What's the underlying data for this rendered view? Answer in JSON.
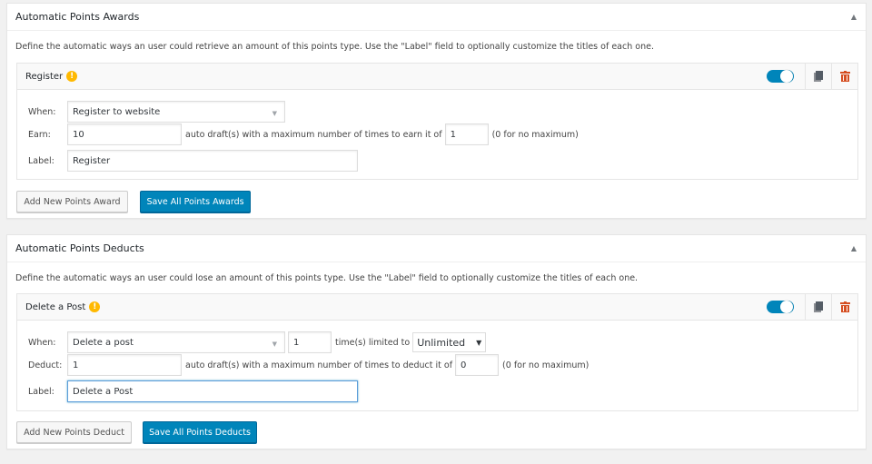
{
  "awards": {
    "title": "Automatic Points Awards",
    "toggle_icon": "triangle-up",
    "description": "Define the automatic ways an user could retrieve an amount of this points type. Use the \"Label\" field to optionally customize the titles of each one.",
    "item": {
      "title": "Register",
      "warning_icon": "!",
      "enabled": true,
      "when_label": "When:",
      "when_value": "Register to website",
      "earn_label": "Earn:",
      "earn_value": "10",
      "earn_suffix": "auto draft(s) with a maximum number of times to earn it of",
      "max_value": "1",
      "max_hint": "(0 for no maximum)",
      "label_label": "Label:",
      "label_value": "Register"
    },
    "add_button": "Add New Points Award",
    "save_button": "Save All Points Awards"
  },
  "deducts": {
    "title": "Automatic Points Deducts",
    "toggle_icon": "triangle-up",
    "description": "Define the automatic ways an user could lose an amount of this points type. Use the \"Label\" field to optionally customize the titles of each one.",
    "item": {
      "title": "Delete a Post",
      "warning_icon": "!",
      "enabled": true,
      "when_label": "When:",
      "when_value": "Delete a post",
      "times_value": "1",
      "times_text": "time(s) limited to",
      "limit_value": "Unlimited",
      "deduct_label": "Deduct:",
      "deduct_value": "1",
      "deduct_suffix": "auto draft(s) with a maximum number of times to deduct it of",
      "max_value": "0",
      "max_hint": "(0 for no maximum)",
      "label_label": "Label:",
      "label_value": "Delete a Post"
    },
    "add_button": "Add New Points Deduct",
    "save_button": "Save All Points Deducts"
  },
  "icons": {
    "collapse": "▲",
    "select_caret": "▼",
    "native_arrow": "▼"
  },
  "colors": {
    "primary": "#0085ba",
    "warning": "#ffb900",
    "danger": "#d54e21"
  }
}
